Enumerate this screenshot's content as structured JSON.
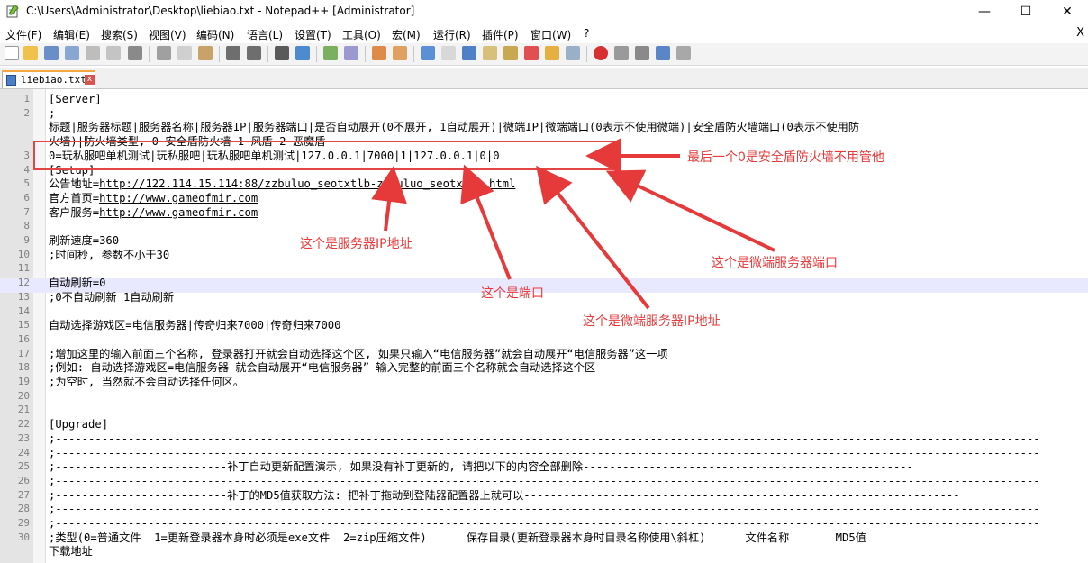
{
  "window": {
    "title": "C:\\Users\\Administrator\\Desktop\\liebiao.txt - Notepad++ [Administrator]",
    "minimize_glyph": "—",
    "maximize_glyph": "☐",
    "close_glyph": "✕"
  },
  "menu": {
    "items": [
      "文件(F)",
      "编辑(E)",
      "搜索(S)",
      "视图(V)",
      "编码(N)",
      "语言(L)",
      "设置(T)",
      "工具(O)",
      "宏(M)",
      "运行(R)",
      "插件(P)",
      "窗口(W)",
      "?"
    ],
    "close_glyph": "X"
  },
  "tab": {
    "label": "liebiao.txt",
    "close_glyph": "x"
  },
  "editor": {
    "lines": [
      {
        "n": "1",
        "text": "[Server]"
      },
      {
        "n": "2",
        "text": ";"
      },
      {
        "n": "",
        "text": "标题|服务器标题|服务器名称|服务器IP|服务器端口|是否自动展开(0不展开, 1自动展开)|微端IP|微端端口(0表示不使用微端)|安全盾防火墙端口(0表示不使用防"
      },
      {
        "n": "",
        "text": "火墙)|防火墙类型, 0 安全盾防火墙 1 风盾 2 恶魔盾"
      },
      {
        "n": "3",
        "text": "0=玩私服吧单机测试|玩私服吧|玩私服吧单机测试|127.0.0.1|7000|1|127.0.0.1|0|0"
      },
      {
        "n": "4",
        "text": "[Setup]"
      },
      {
        "n": "5",
        "text": "公告地址=",
        "link": "http://122.114.15.114:88/zzbuluo_seotxtlb-zzbuluo_seotxtlb.html"
      },
      {
        "n": "6",
        "text": "官方首页=",
        "link": "http://www.gameofmir.com"
      },
      {
        "n": "7",
        "text": "客户服务=",
        "link": "http://www.gameofmir.com"
      },
      {
        "n": "8",
        "text": ""
      },
      {
        "n": "9",
        "text": "刷新速度=360"
      },
      {
        "n": "10",
        "text": ";时间秒, 参数不小于30"
      },
      {
        "n": "11",
        "text": ""
      },
      {
        "n": "12",
        "text": "自动刷新=0"
      },
      {
        "n": "13",
        "text": ";0不自动刷新 1自动刷新"
      },
      {
        "n": "14",
        "text": ""
      },
      {
        "n": "15",
        "text": "自动选择游戏区=电信服务器|传奇归来7000|传奇归来7000"
      },
      {
        "n": "16",
        "text": ""
      },
      {
        "n": "17",
        "text": ";增加这里的输入前面三个名称, 登录器打开就会自动选择这个区, 如果只输入“电信服务器”就会自动展开“电信服务器”这一项"
      },
      {
        "n": "18",
        "text": ";例如: 自动选择游戏区=电信服务器 就会自动展开“电信服务器” 输入完整的前面三个名称就会自动选择这个区"
      },
      {
        "n": "19",
        "text": ";为空时, 当然就不会自动选择任何区。"
      },
      {
        "n": "20",
        "text": ""
      },
      {
        "n": "21",
        "text": ""
      },
      {
        "n": "22",
        "text": "[Upgrade]"
      },
      {
        "n": "23",
        "text": ";-----------------------------------------------------------------------------------------------------------------------------------------------------"
      },
      {
        "n": "24",
        "text": ";-----------------------------------------------------------------------------------------------------------------------------------------------------"
      },
      {
        "n": "25",
        "text": ";--------------------------补丁自动更新配置演示, 如果没有补丁更新的, 请把以下的内容全部删除--------------------------------------------------"
      },
      {
        "n": "26",
        "text": ";-----------------------------------------------------------------------------------------------------------------------------------------------------"
      },
      {
        "n": "27",
        "text": ";--------------------------补丁的MD5值获取方法: 把补丁拖动到登陆器配置器上就可以------------------------------------------------------------------"
      },
      {
        "n": "28",
        "text": ";-----------------------------------------------------------------------------------------------------------------------------------------------------"
      },
      {
        "n": "29",
        "text": ";-----------------------------------------------------------------------------------------------------------------------------------------------------"
      },
      {
        "n": "30",
        "text": ";类型(0=普通文件  1=更新登录器本身时必须是exe文件  2=zip压缩文件)      保存目录(更新登录器本身时目录名称使用\\斜杠)      文件名称       MD5值"
      },
      {
        "n": "",
        "text": "下载地址"
      }
    ]
  },
  "annotations": {
    "last_zero": "最后一个0是安全盾防火墙不用管他",
    "server_ip": "这个是服务器IP地址",
    "port": "这个是端口",
    "micro_ip": "这个是微端服务器IP地址",
    "micro_port": "这个是微端服务器端口"
  },
  "colors": {
    "annotation": "#e63a3a",
    "current_line": "#e8e8ff",
    "tab_accent": "#f4a640"
  }
}
